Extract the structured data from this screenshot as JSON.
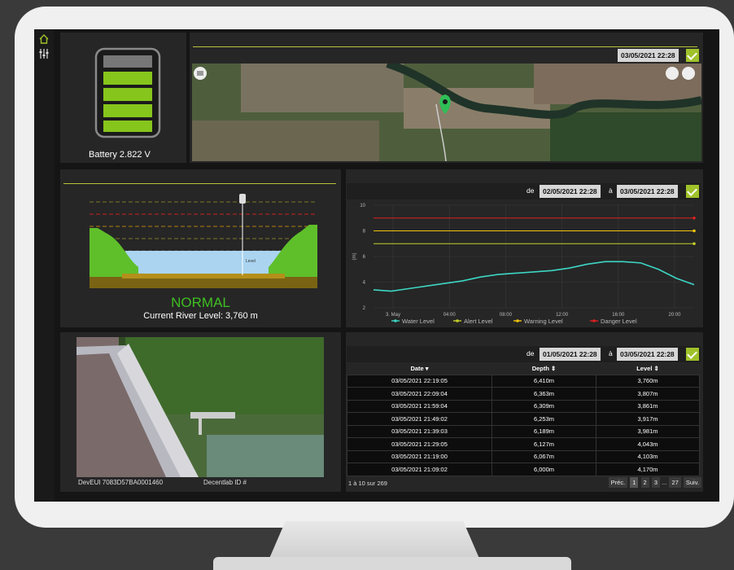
{
  "battery": {
    "label": "Battery 2.822 V"
  },
  "map": {
    "timestamp": "03/05/2021 22:28"
  },
  "river": {
    "status": "NORMAL",
    "current_level": "Current River Level: 3,760 m",
    "level_marker": "Level"
  },
  "chart_panel": {
    "from_label": "de",
    "from_date": "02/05/2021 22:28",
    "to_label": "à",
    "to_date": "03/05/2021 22:28"
  },
  "chart_data": {
    "type": "line",
    "ylabel": "(m)",
    "ylim": [
      2,
      10
    ],
    "yticks": [
      "2",
      "4",
      "6",
      "8",
      "10"
    ],
    "x_ticks": [
      "3. May",
      "04:00",
      "08:00",
      "12:00",
      "16:00",
      "20:00"
    ],
    "series": [
      {
        "name": "Water Level",
        "color": "#3dd6c4",
        "values": [
          3.4,
          3.3,
          3.5,
          3.7,
          3.9,
          4.1,
          4.4,
          4.6,
          4.7,
          4.8,
          4.9,
          5.1,
          5.4,
          5.6,
          5.6,
          5.5,
          5.0,
          4.3,
          3.8
        ]
      },
      {
        "name": "Alert Level",
        "color": "#c4cf2a",
        "values": [
          7.0,
          7.0
        ]
      },
      {
        "name": "Warning Level",
        "color": "#f1c40f",
        "values": [
          8.0,
          8.0
        ]
      },
      {
        "name": "Danger Level",
        "color": "#e02020",
        "values": [
          9.0,
          9.0
        ]
      }
    ]
  },
  "photo": {
    "devEUI": "DevEUI 7083D57BA0001460",
    "decentlab": "Decentlab ID #"
  },
  "table_panel": {
    "from_label": "de",
    "from_date": "01/05/2021 22:28",
    "to_label": "à",
    "to_date": "03/05/2021 22:28",
    "headers": {
      "date": "Date ▾",
      "depth": "Depth ⇕",
      "level": "Level ⇕"
    },
    "rows": [
      [
        "03/05/2021 22:19:05",
        "6,410m",
        "3,760m"
      ],
      [
        "03/05/2021 22:09:04",
        "6,363m",
        "3,807m"
      ],
      [
        "03/05/2021 21:59:04",
        "6,309m",
        "3,861m"
      ],
      [
        "03/05/2021 21:49:02",
        "6,253m",
        "3,917m"
      ],
      [
        "03/05/2021 21:39:03",
        "6,189m",
        "3,981m"
      ],
      [
        "03/05/2021 21:29:05",
        "6,127m",
        "4,043m"
      ],
      [
        "03/05/2021 21:19:00",
        "6,067m",
        "4,103m"
      ],
      [
        "03/05/2021 21:09:02",
        "6,000m",
        "4,170m"
      ]
    ],
    "summary": "1 à 10 sur 269",
    "pager": {
      "prev": "Préc.",
      "pages": [
        "1",
        "2",
        "3",
        "...",
        "27"
      ],
      "next": "Suiv."
    }
  }
}
